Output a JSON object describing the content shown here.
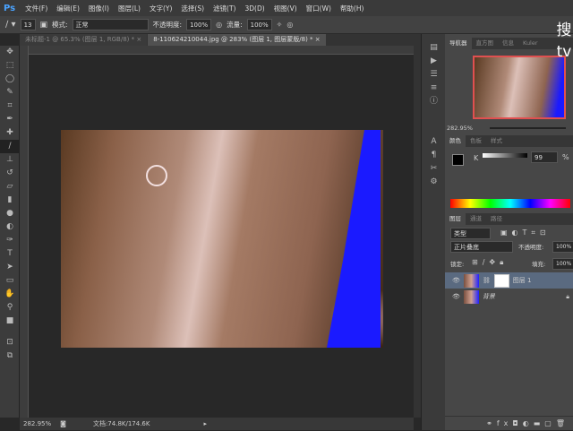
{
  "app": {
    "logo": "Ps"
  },
  "menu": [
    "文件(F)",
    "编辑(E)",
    "图像(I)",
    "图层(L)",
    "文字(Y)",
    "选择(S)",
    "滤镜(T)",
    "3D(D)",
    "视图(V)",
    "窗口(W)",
    "帮助(H)"
  ],
  "options": {
    "brush_size": "13",
    "mode_label": "模式:",
    "mode_value": "正常",
    "opacity_label": "不透明度:",
    "opacity_value": "100%",
    "flow_label": "流量:",
    "flow_value": "100%"
  },
  "tabs": [
    {
      "label": "未标题-1 @ 65.3% (图层 1, RGB/8) *",
      "close": "×"
    },
    {
      "label": "8-110624210044.jpg @ 283% (图层 1, 图层蒙版/8) *",
      "close": "×"
    }
  ],
  "status": {
    "zoom": "282.95%",
    "doc": "文档:74.8K/174.6K"
  },
  "navigator": {
    "tabs": [
      "导航器",
      "直方图",
      "信息",
      "Kuler"
    ],
    "zoom": "282.95%"
  },
  "color": {
    "tabs": [
      "颜色",
      "色板",
      "样式"
    ],
    "channel": "K",
    "value": "99",
    "unit": "%"
  },
  "layers": {
    "tabs": [
      "图层",
      "通道",
      "路径"
    ],
    "filter": "类型",
    "blend": "正片叠底",
    "opacity_label": "不透明度:",
    "opacity": "100%",
    "lock_label": "锁定:",
    "fill_label": "填充:",
    "fill": "100%",
    "items": [
      {
        "name": "图层 1"
      },
      {
        "name": "背景"
      }
    ]
  },
  "watermark": "搜 tv"
}
